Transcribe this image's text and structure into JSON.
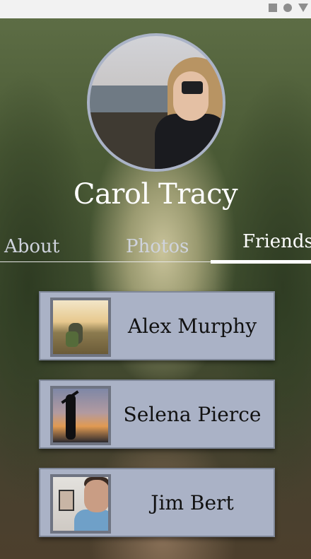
{
  "status_bar": {
    "icons": [
      "square-icon",
      "circle-icon",
      "triangle-down-icon"
    ]
  },
  "profile": {
    "name": "Carol Tracy"
  },
  "tabs": [
    {
      "label": "About",
      "active": false
    },
    {
      "label": "Photos",
      "active": false
    },
    {
      "label": "Friends",
      "active": true
    }
  ],
  "friends": [
    {
      "name": "Alex Murphy"
    },
    {
      "name": "Selena Pierce"
    },
    {
      "name": "Jim Bert"
    }
  ],
  "colors": {
    "card_background": "#aab2c6",
    "avatar_border": "#aab3c7",
    "active_tab": "#ffffff",
    "inactive_tab": "#cfd3dd"
  }
}
